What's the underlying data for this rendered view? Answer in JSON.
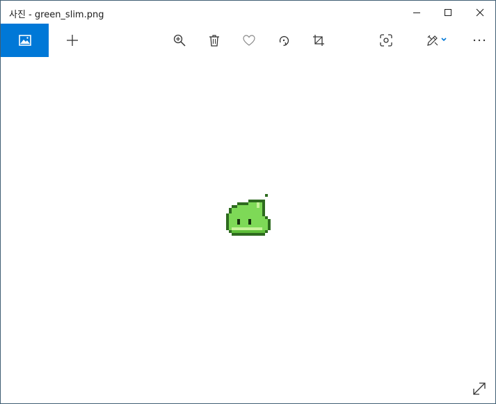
{
  "window": {
    "app_name": "사진",
    "separator": " - ",
    "file_name": "green_slim.png"
  },
  "titlebar": {
    "buttons": [
      "minimize",
      "maximize",
      "close"
    ]
  },
  "toolbar": {
    "collection_icon": "photo-collection-icon",
    "add_icon": "plus-icon",
    "zoom_icon": "zoom-in-icon",
    "delete_icon": "trash-icon",
    "favorite_icon": "heart-icon",
    "rotate_icon": "rotate-icon",
    "crop_icon": "crop-icon",
    "visual_search_icon": "visual-search-icon",
    "edit_icon": "edit-create-icon",
    "more_icon": "more-icon",
    "accent_color": "#0078d7"
  },
  "image": {
    "description_icon": "green-slime-sprite",
    "primary_color": "#7ed957",
    "outline_color": "#2e6b1f"
  }
}
